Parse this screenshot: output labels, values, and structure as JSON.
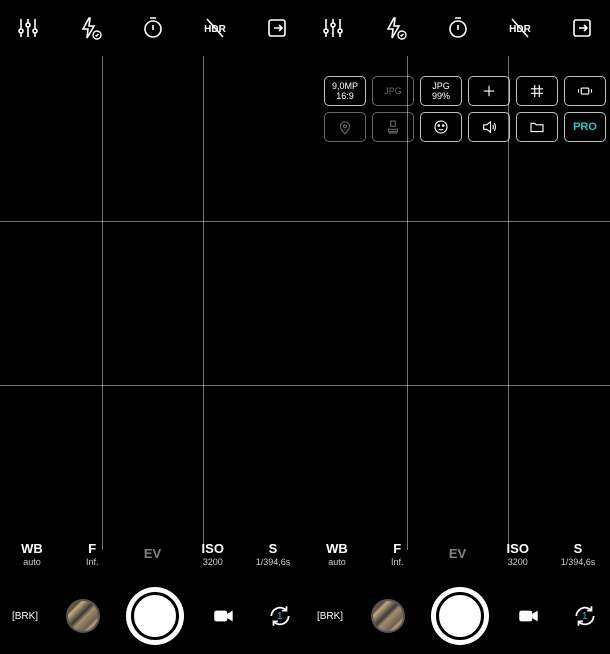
{
  "colors": {
    "accent": "#1ec8c8"
  },
  "topIcons": [
    "sliders",
    "flash",
    "timer",
    "hdr",
    "exit"
  ],
  "options": {
    "resolution": {
      "line1": "9,0MP",
      "line2": "16:9"
    },
    "format": "JPG",
    "quality": {
      "line1": "JPG",
      "line2": "99%"
    },
    "pro": "PRO"
  },
  "pro": {
    "wb": {
      "label": "WB",
      "value": "auto"
    },
    "f": {
      "label": "F",
      "value": "Inf."
    },
    "ev": {
      "label": "EV",
      "value": ""
    },
    "iso": {
      "label": "ISO",
      "value": "3200"
    },
    "s": {
      "label": "S",
      "value": "1/394,6s"
    }
  },
  "bottom": {
    "bracket": "[BRK]",
    "switchCount": "1"
  }
}
